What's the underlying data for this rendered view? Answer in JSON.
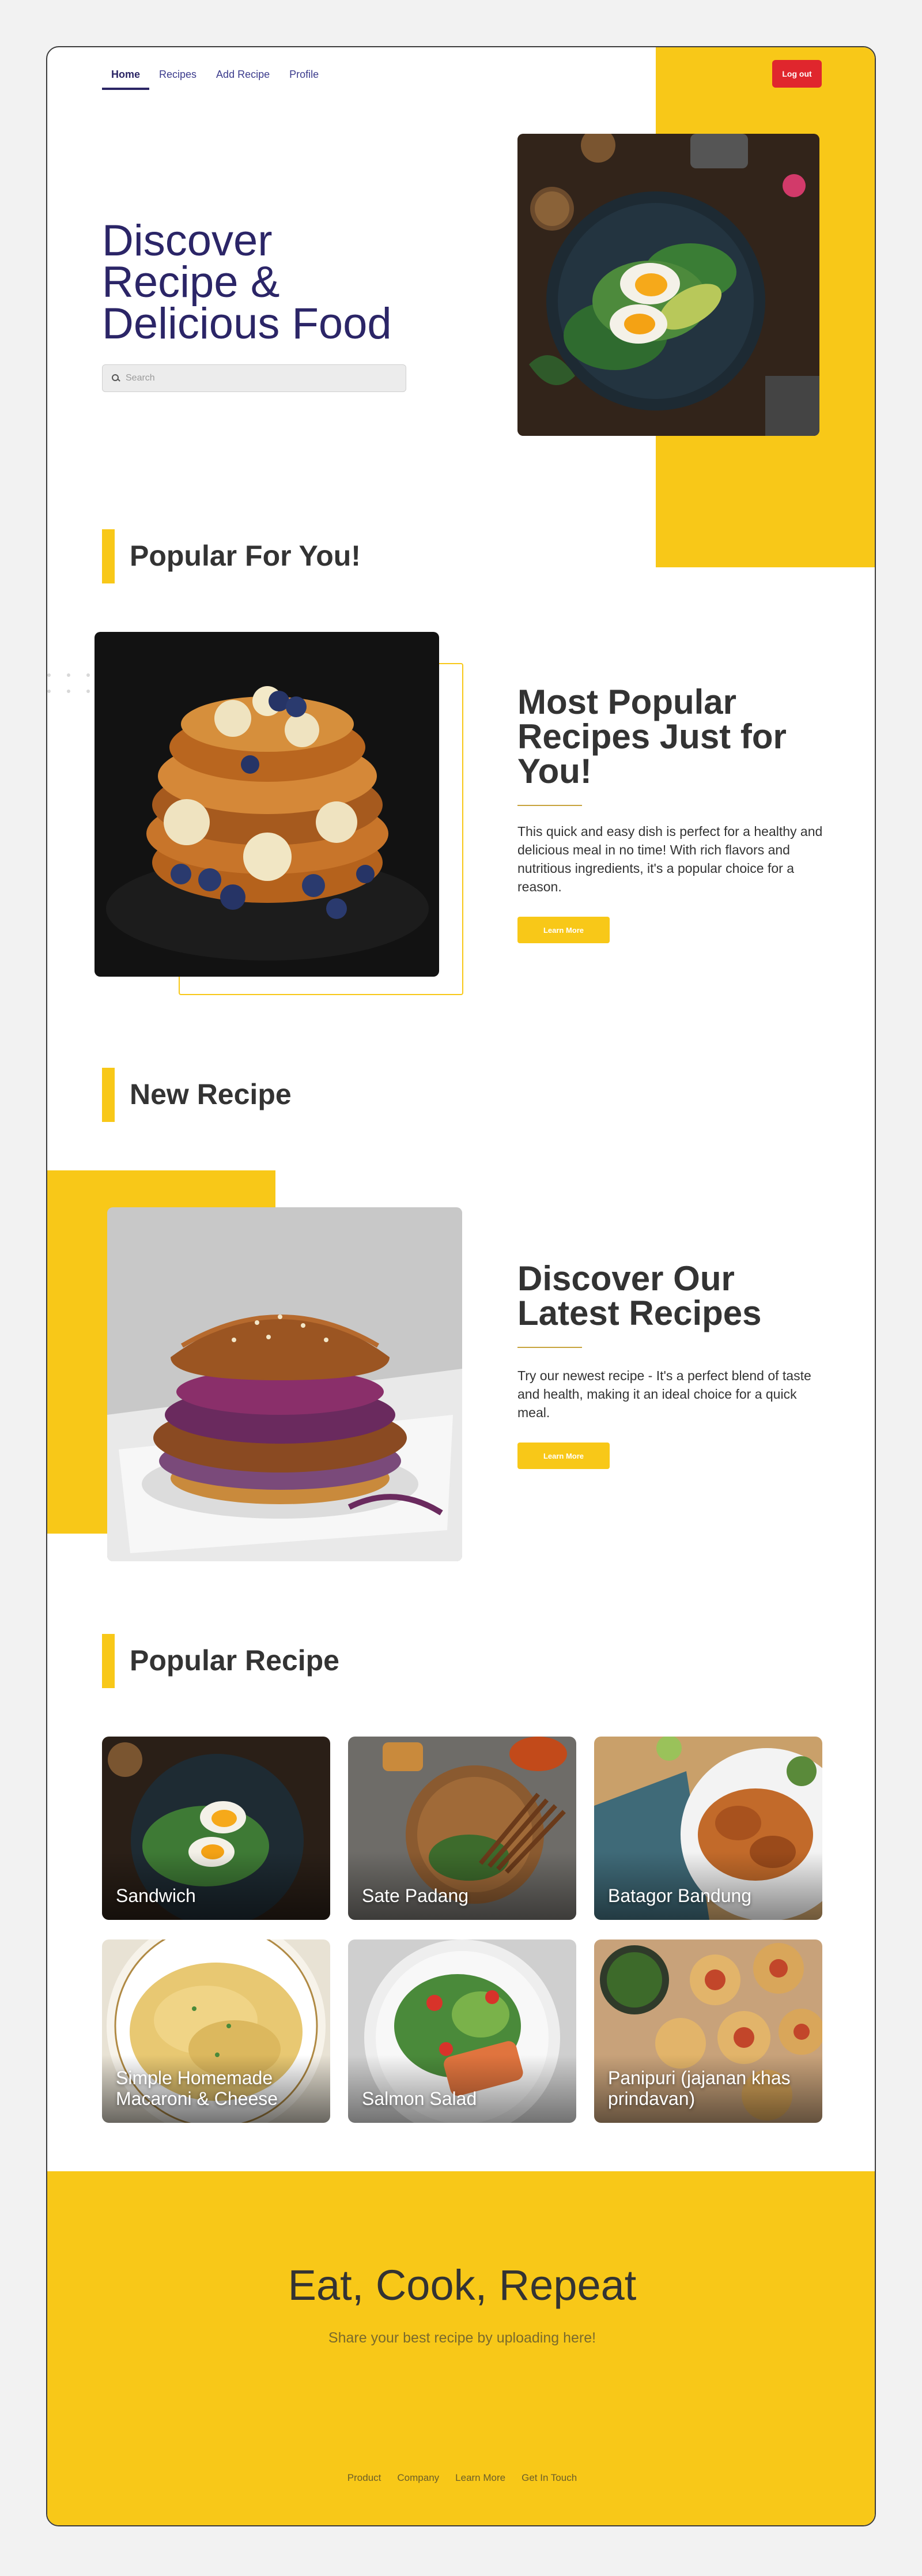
{
  "nav": {
    "items": [
      {
        "label": "Home",
        "active": true
      },
      {
        "label": "Recipes",
        "active": false
      },
      {
        "label": "Add Recipe",
        "active": false
      },
      {
        "label": "Profile",
        "active": false
      }
    ],
    "logout_label": "Log out"
  },
  "hero": {
    "title_lines": [
      "Discover",
      "Recipe &",
      "Delicious Food"
    ],
    "search_placeholder": "Search",
    "image": "egg-avocado-spinach-plate"
  },
  "popular_for_you": {
    "heading": "Popular For You!",
    "title": "Most Popular Recipes Just for You!",
    "description": "This quick and easy dish is perfect for a healthy and delicious meal in no time! With rich flavors and nutritious ingredients, it's a popular choice for a reason.",
    "button_label": "Learn More",
    "image": "french-toast-blueberry-banana"
  },
  "new_recipe": {
    "heading": "New Recipe",
    "title": "Discover Our Latest Recipes",
    "description": "Try our newest recipe - It's a perfect blend of taste and health, making it an ideal choice for a quick meal.",
    "button_label": "Learn More",
    "image": "fried-chicken-burger"
  },
  "popular_recipe": {
    "heading": "Popular Recipe",
    "cards": [
      {
        "label": "Sandwich",
        "image": "egg-avocado-plate"
      },
      {
        "label": "Sate Padang",
        "image": "satay-skewers"
      },
      {
        "label": "Batagor Bandung",
        "image": "batagor-plate"
      },
      {
        "label": "Simple Homemade Macaroni & Cheese",
        "image": "mac-and-cheese"
      },
      {
        "label": "Salmon Salad",
        "image": "salmon-salad"
      },
      {
        "label": "Panipuri (jajanan khas prindavan)",
        "image": "panipuri"
      }
    ]
  },
  "footer": {
    "title": "Eat, Cook, Repeat",
    "subtitle": "Share your best recipe by uploading here!",
    "links": [
      "Product",
      "Company",
      "Learn More",
      "Get In Touch"
    ]
  },
  "colors": {
    "accent_yellow": "#f8c818",
    "brand_navy": "#2b2567",
    "logout_red": "#e0262d"
  }
}
